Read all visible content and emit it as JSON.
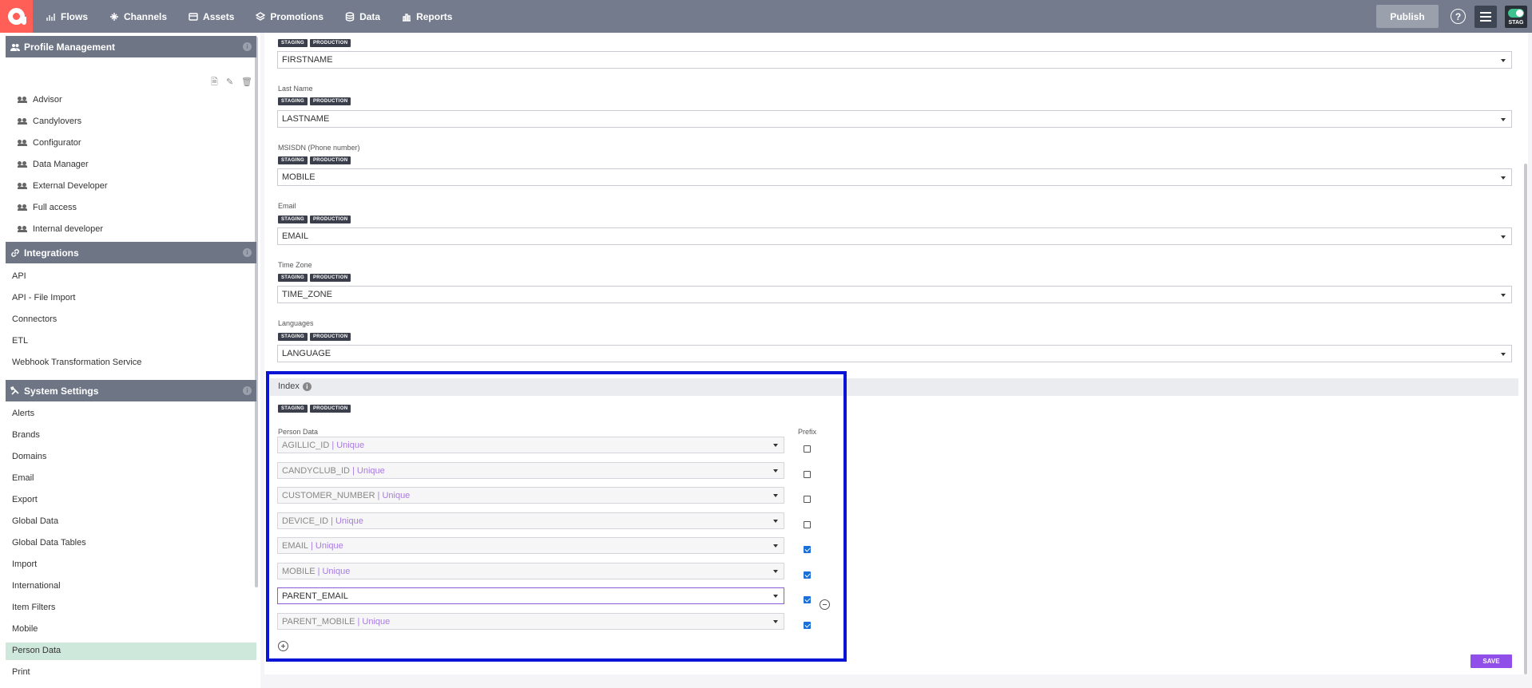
{
  "topbar": {
    "nav": [
      "Flows",
      "Channels",
      "Assets",
      "Promotions",
      "Data",
      "Reports"
    ],
    "publish": "Publish",
    "help": "?",
    "env": "STAG"
  },
  "sidebar": {
    "profile_section": "Profile Management",
    "profiles": [
      "Advisor",
      "Candylovers",
      "Configurator",
      "Data Manager",
      "External Developer",
      "Full access",
      "Internal developer"
    ],
    "integrations_section": "Integrations",
    "integrations": [
      "API",
      "API - File Import",
      "Connectors",
      "ETL",
      "Webhook Transformation Service"
    ],
    "system_section": "System Settings",
    "system": [
      "Alerts",
      "Brands",
      "Domains",
      "Email",
      "Export",
      "Global Data",
      "Global Data Tables",
      "Import",
      "International",
      "Item Filters",
      "Mobile",
      "Person Data",
      "Print"
    ],
    "info": "i"
  },
  "badges": {
    "staging": "STAGING",
    "production": "PRODUCTION"
  },
  "fields": [
    {
      "label": "",
      "value": "FIRSTNAME"
    },
    {
      "label": "Last Name",
      "value": "LASTNAME"
    },
    {
      "label": "MSISDN (Phone number)",
      "value": "MOBILE"
    },
    {
      "label": "Email",
      "value": "EMAIL"
    },
    {
      "label": "Time Zone",
      "value": "TIME_ZONE"
    },
    {
      "label": "Languages",
      "value": "LANGUAGE"
    }
  ],
  "index": {
    "title": "Index",
    "person_data_label": "Person Data",
    "prefix_label": "Prefix",
    "unique_suffix": "| Unique",
    "rows": [
      {
        "name": "AGILLIC_ID",
        "unique": true,
        "prefix": false
      },
      {
        "name": "CANDYCLUB_ID",
        "unique": true,
        "prefix": false
      },
      {
        "name": "CUSTOMER_NUMBER",
        "unique": true,
        "prefix": false
      },
      {
        "name": "DEVICE_ID",
        "unique": true,
        "prefix": false
      },
      {
        "name": "EMAIL",
        "unique": true,
        "prefix": true
      },
      {
        "name": "MOBILE",
        "unique": true,
        "prefix": true
      },
      {
        "name": "PARENT_EMAIL",
        "unique": false,
        "prefix": true
      },
      {
        "name": "PARENT_MOBILE",
        "unique": true,
        "prefix": true
      }
    ]
  },
  "save": "SAVE",
  "colors": {
    "topbar": "#737b8d",
    "accent": "#8f4fe8",
    "highlight": "#0a14d6",
    "logo": "#ff5f57"
  }
}
